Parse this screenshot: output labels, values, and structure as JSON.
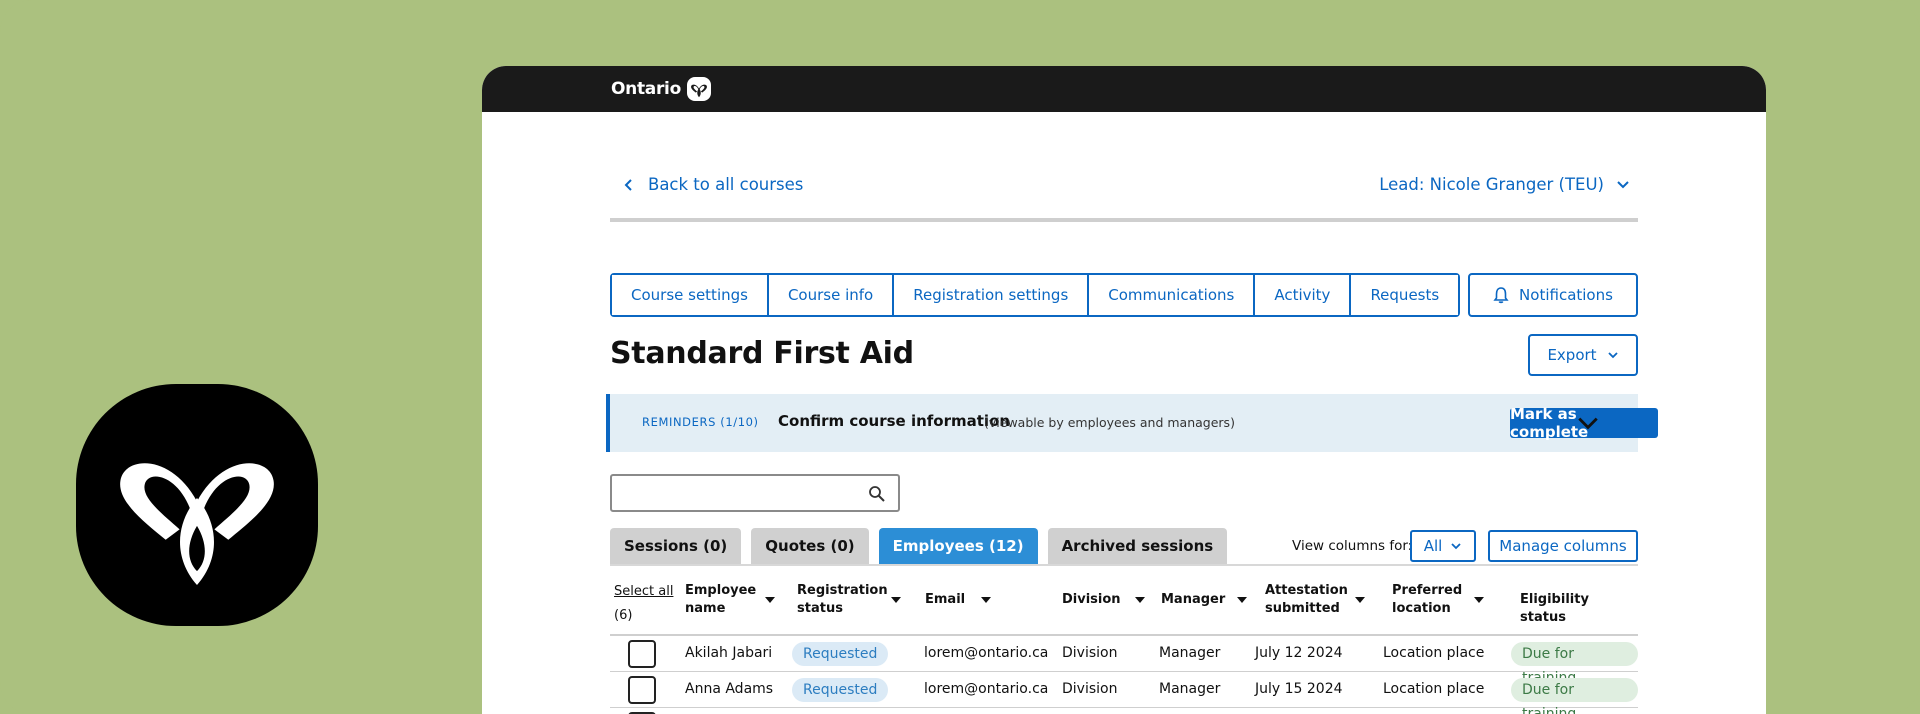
{
  "brand": {
    "name": "Ontario"
  },
  "nav": {
    "back_label": "Back to all courses",
    "lead_label": "Lead: Nicole Granger (TEU)"
  },
  "course_tabs": [
    "Course settings",
    "Course info",
    "Registration settings",
    "Communications",
    "Activity",
    "Requests"
  ],
  "notifications_label": "Notifications",
  "page_title": "Standard First Aid",
  "export_label": "Export",
  "reminder": {
    "label": "REMINDERS (1/10)",
    "title": "Confirm course information",
    "subtitle": "(viewable by employees and managers)",
    "action_label": "Mark as complete"
  },
  "search": {
    "value": "",
    "placeholder": ""
  },
  "sub_tabs": [
    {
      "label": "Sessions (0)",
      "active": false
    },
    {
      "label": "Quotes (0)",
      "active": false
    },
    {
      "label": "Employees (12)",
      "active": true
    },
    {
      "label": "Archived sessions",
      "active": false
    }
  ],
  "view_columns": {
    "label": "View columns for:",
    "value": "All",
    "manage_label": "Manage columns"
  },
  "table": {
    "select_all": "Select all",
    "select_count": "(6)",
    "columns": [
      "Employee name",
      "Registration status",
      "Email",
      "Division",
      "Manager",
      "Attestation submitted",
      "Preferred location",
      "Eligibility status"
    ],
    "rows": [
      {
        "name": "Akilah Jabari",
        "status": "Requested",
        "email": "lorem@ontario.ca",
        "division": "Division",
        "manager": "Manager",
        "attestation": "July 12 2024",
        "location": "Location place",
        "eligibility": "Due for training"
      },
      {
        "name": "Anna Adams",
        "status": "Requested",
        "email": "lorem@ontario.ca",
        "division": "Division",
        "manager": "Manager",
        "attestation": "July 15 2024",
        "location": "Location place",
        "eligibility": "Due for training"
      }
    ]
  },
  "colors": {
    "background": "#abc17f",
    "accent": "#0b67c2",
    "tab_active": "#2c8ed6",
    "banner": "#e3eef5"
  }
}
